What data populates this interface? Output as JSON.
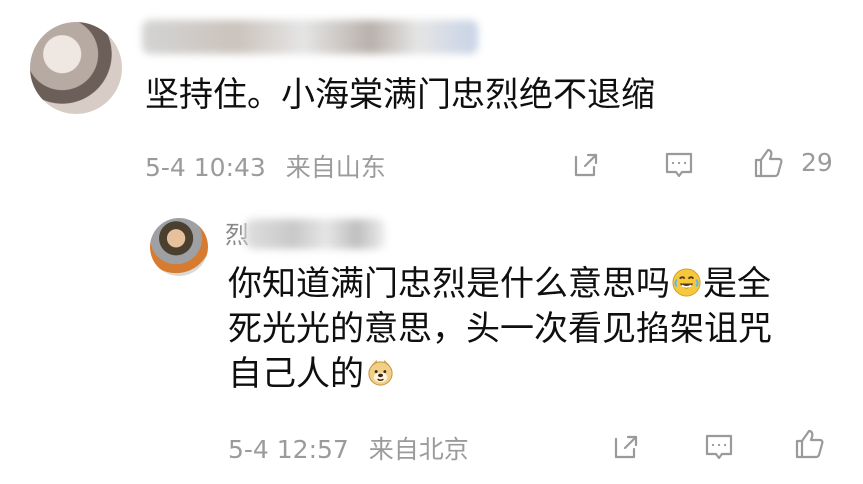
{
  "comment": {
    "text": "坚持住。小海棠满门忠烈绝不退缩",
    "time": "5-4 10:43",
    "location": "来自山东",
    "likes": "29",
    "icons": {
      "share": "share-icon",
      "comment": "comment-icon",
      "like": "thumbs-up-icon"
    }
  },
  "reply": {
    "name_visible_char": "烈",
    "text_line1": "你知道满门忠烈是什么意思吗",
    "text_line1_after": "是全",
    "text_line2": "死光光的意思，头一次看见掐架诅咒",
    "text_line3": "自己人的",
    "time": "5-4 12:57",
    "location": "来自北京",
    "icons": {
      "laugh": "laughing-emoji-icon",
      "doge": "dog-face-emoji-icon",
      "share": "share-icon",
      "comment": "comment-icon",
      "like": "thumbs-up-icon"
    }
  },
  "colors": {
    "text": "#111111",
    "meta": "#9b9b9b",
    "icon": "#9a9a9a",
    "background": "#ffffff"
  }
}
